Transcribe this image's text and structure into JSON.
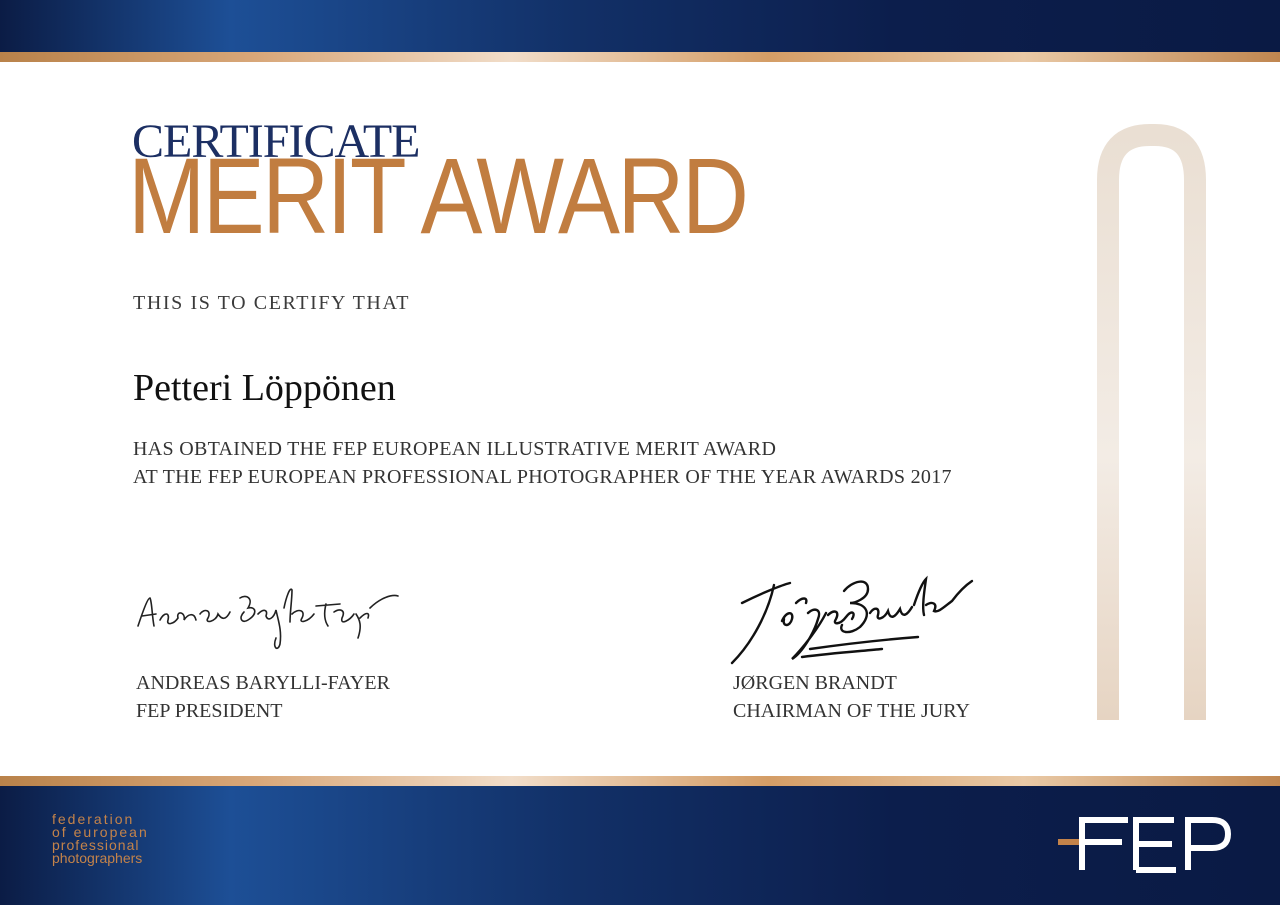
{
  "certificate": {
    "title_small": "CERTIFICATE",
    "title_large": "MERIT AWARD",
    "certify_text": "THIS IS TO CERTIFY THAT",
    "recipient": "Petteri Löppönen",
    "award_line1": "HAS OBTAINED THE FEP EUROPEAN ILLUSTRATIVE MERIT AWARD",
    "award_line2": "AT THE FEP EUROPEAN PROFESSIONAL PHOTOGRAPHER OF THE YEAR AWARDS 2017"
  },
  "signatories": [
    {
      "name": "ANDREAS BARYLLI-FAYER",
      "role": "FEP PRESIDENT",
      "signature": "Andreas Barylli-Fayer"
    },
    {
      "name": "JØRGEN BRANDT",
      "role": "CHAIRMAN OF THE JURY",
      "signature": "Jørgen Brandt"
    }
  ],
  "footer": {
    "org_lines": [
      "federation",
      "of european",
      "professional",
      "photographers"
    ],
    "logo_text": "FEP"
  },
  "colors": {
    "navy": "#0b1c45",
    "blue": "#1d4f96",
    "copper": "#c17d40",
    "title_blue": "#1c2f63"
  },
  "icons": [
    "fep-watermark-icon",
    "fep-logo-icon",
    "signature-icon"
  ]
}
